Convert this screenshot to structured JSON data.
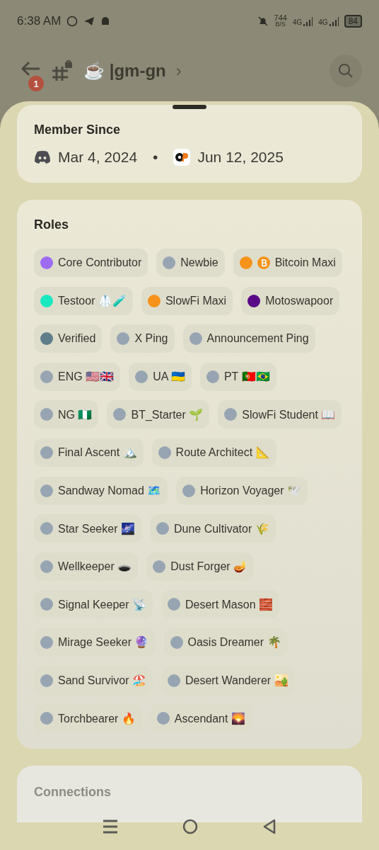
{
  "status_bar": {
    "time": "6:38 AM",
    "net_speed": "744",
    "net_unit": "B/S",
    "sim1": "4G",
    "sim2": "4G",
    "battery": "84"
  },
  "header": {
    "back_badge": "1",
    "channel": "☕ |gm-gn",
    "chevron": "›"
  },
  "member_since": {
    "title": "Member Since",
    "discord_date": "Mar 4, 2024",
    "separator": "•",
    "server_date": "Jun 12, 2025"
  },
  "roles": {
    "title": "Roles",
    "items": [
      {
        "name": "Core Contributor",
        "color": "#9d6cf2"
      },
      {
        "name": "Newbie",
        "color": "#97a5b2"
      },
      {
        "name": "Bitcoin Maxi",
        "color": "#f7931a",
        "kind": "with_icon"
      },
      {
        "name": "Testoor 🥼🧪",
        "color": "#1ae8c0"
      },
      {
        "name": "SlowFi Maxi",
        "color": "#f7931a"
      },
      {
        "name": "Motoswapoor",
        "color": "#5a0a86"
      },
      {
        "name": "Verified",
        "color": "#607d8b"
      },
      {
        "name": "X Ping",
        "color": "#97a5b2"
      },
      {
        "name": "Announcement Ping",
        "color": "#97a5b2"
      },
      {
        "name": "ENG 🇺🇸🇬🇧",
        "color": "#97a5b2"
      },
      {
        "name": "UA 🇺🇦",
        "color": "#97a5b2"
      },
      {
        "name": "PT 🇵🇹🇧🇷",
        "color": "#97a5b2"
      },
      {
        "name": "NG 🇳🇬",
        "color": "#97a5b2"
      },
      {
        "name": "BT_Starter 🌱",
        "color": "#97a5b2"
      },
      {
        "name": "SlowFi Student 📖",
        "color": "#97a5b2"
      },
      {
        "name": "Final Ascent 🏔️",
        "color": "#97a5b2"
      },
      {
        "name": "Route Architect 📐",
        "color": "#97a5b2"
      },
      {
        "name": "Sandway Nomad 🗺️",
        "color": "#97a5b2"
      },
      {
        "name": "Horizon Voyager 🕊️",
        "color": "#97a5b2"
      },
      {
        "name": "Star Seeker 🌌",
        "color": "#97a5b2"
      },
      {
        "name": "Dune Cultivator 🌾",
        "color": "#97a5b2"
      },
      {
        "name": "Wellkeeper 🕳️",
        "color": "#97a5b2"
      },
      {
        "name": "Dust Forger 🪔",
        "color": "#97a5b2"
      },
      {
        "name": "Signal Keeper 📡",
        "color": "#97a5b2"
      },
      {
        "name": "Desert Mason 🧱",
        "color": "#97a5b2"
      },
      {
        "name": "Mirage Seeker 🔮",
        "color": "#97a5b2"
      },
      {
        "name": "Oasis Dreamer 🌴",
        "color": "#97a5b2"
      },
      {
        "name": "Sand Survivor 🏖️",
        "color": "#97a5b2"
      },
      {
        "name": "Desert Wanderer 🏜️",
        "color": "#97a5b2"
      },
      {
        "name": "Torchbearer 🔥",
        "color": "#97a5b2"
      },
      {
        "name": "Ascendant 🌄",
        "color": "#97a5b2"
      }
    ]
  },
  "connections": {
    "title": "Connections"
  }
}
